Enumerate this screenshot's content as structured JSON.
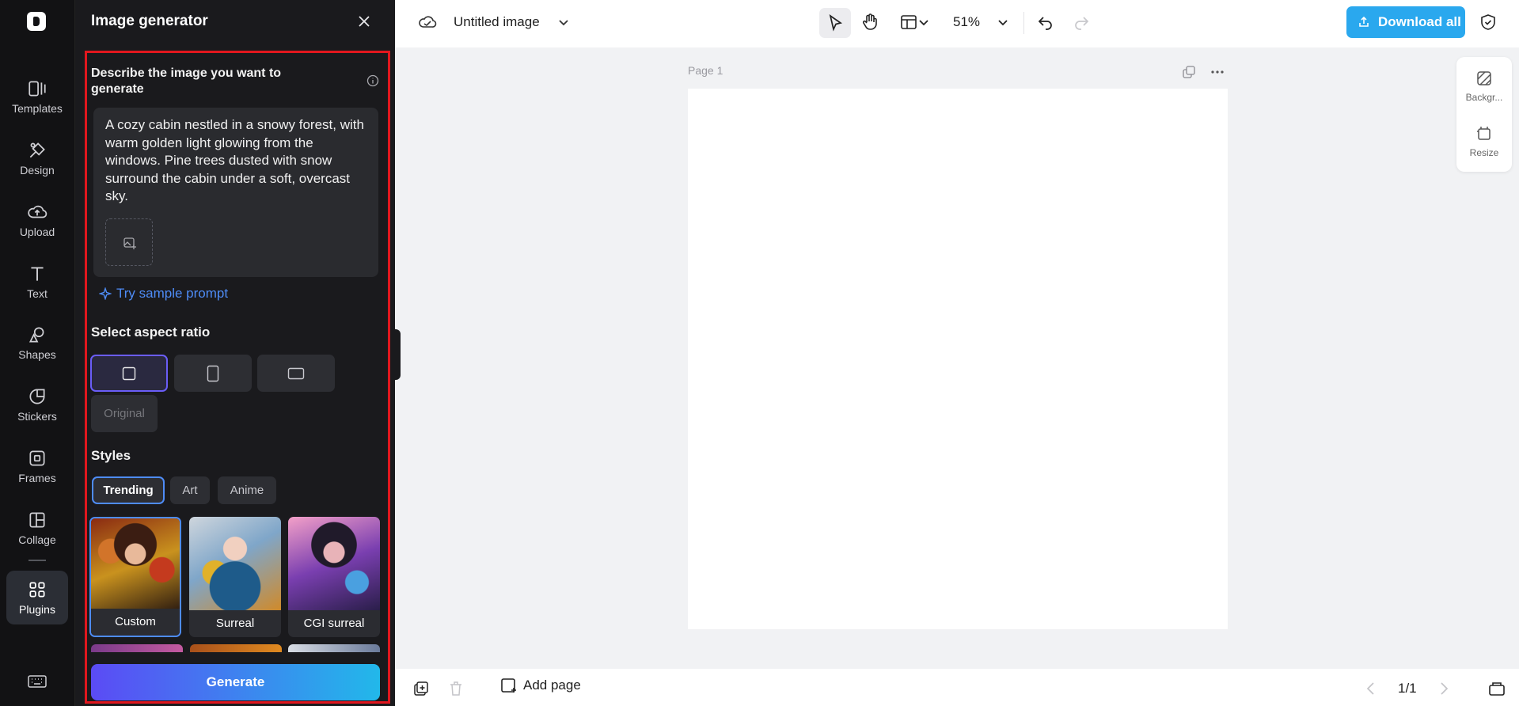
{
  "rail": {
    "items": [
      {
        "label": "Templates",
        "icon": "templates-icon"
      },
      {
        "label": "Design",
        "icon": "design-icon"
      },
      {
        "label": "Upload",
        "icon": "upload-icon"
      },
      {
        "label": "Text",
        "icon": "text-icon"
      },
      {
        "label": "Shapes",
        "icon": "shapes-icon"
      },
      {
        "label": "Stickers",
        "icon": "stickers-icon"
      },
      {
        "label": "Frames",
        "icon": "frames-icon"
      },
      {
        "label": "Collage",
        "icon": "collage-icon"
      },
      {
        "label": "Plugins",
        "icon": "plugins-icon",
        "active": true
      }
    ]
  },
  "panel": {
    "title": "Image generator",
    "describe_label": "Describe the image you want to generate",
    "prompt": "A cozy cabin nestled in a snowy forest, with warm golden light glowing from the windows. Pine trees dusted with snow surround the cabin under a soft, overcast sky.",
    "sample_prompt": "Try sample prompt",
    "aspect_label": "Select aspect ratio",
    "aspect_original": "Original",
    "styles_label": "Styles",
    "style_tabs": [
      "Trending",
      "Art",
      "Anime"
    ],
    "style_cards": [
      "Custom",
      "Surreal",
      "CGI surreal"
    ],
    "generate": "Generate"
  },
  "topbar": {
    "doc_title": "Untitled image",
    "zoom": "51%",
    "download_all": "Download all"
  },
  "canvas": {
    "page_label": "Page 1"
  },
  "right_tools": {
    "background": "Backgr...",
    "resize": "Resize"
  },
  "bottombar": {
    "add_page": "Add page",
    "page_count": "1/1"
  },
  "colors": {
    "accent": "#2aa8ee",
    "selection": "#4e8cf7",
    "panel_bg": "#1a1a1d",
    "highlight_frame": "#e1171e"
  }
}
